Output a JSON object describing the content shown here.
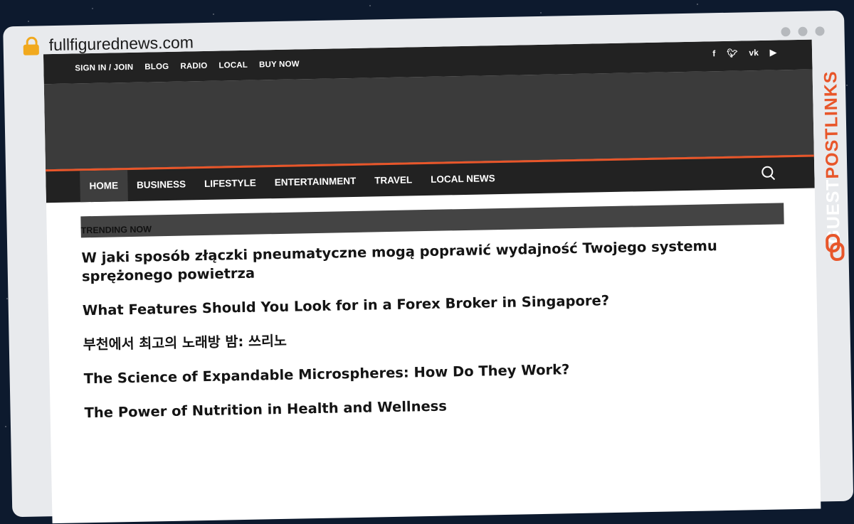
{
  "browser": {
    "url": "fullfigurednews.com"
  },
  "site": {
    "top_links": [
      "SIGN IN / JOIN",
      "BLOG",
      "RADIO",
      "LOCAL",
      "BUY NOW"
    ],
    "social_icons": [
      "facebook-icon",
      "twitter-icon",
      "vk-icon",
      "youtube-icon"
    ],
    "nav": [
      {
        "label": "HOME",
        "active": true
      },
      {
        "label": "BUSINESS",
        "active": false
      },
      {
        "label": "LIFESTYLE",
        "active": false
      },
      {
        "label": "ENTERTAINMENT",
        "active": false
      },
      {
        "label": "TRAVEL",
        "active": false
      },
      {
        "label": "LOCAL NEWS",
        "active": false
      }
    ],
    "accent_color": "#e8562a"
  },
  "trending": {
    "label": "TRENDING NOW",
    "posts": [
      "W jaki sposób złączki pneumatyczne mogą poprawić wydajność Twojego systemu sprężonego powietrza",
      "What Features Should You Look for in a Forex Broker in Singapore?",
      "부천에서 최고의 노래방 밤: 쓰리노",
      "The Science of Expandable Microspheres: How Do They Work?",
      "The Power of Nutrition in Health and Wellness"
    ]
  },
  "brand": {
    "name_part1": "GUEST",
    "name_part2": "POSTLINKS"
  }
}
